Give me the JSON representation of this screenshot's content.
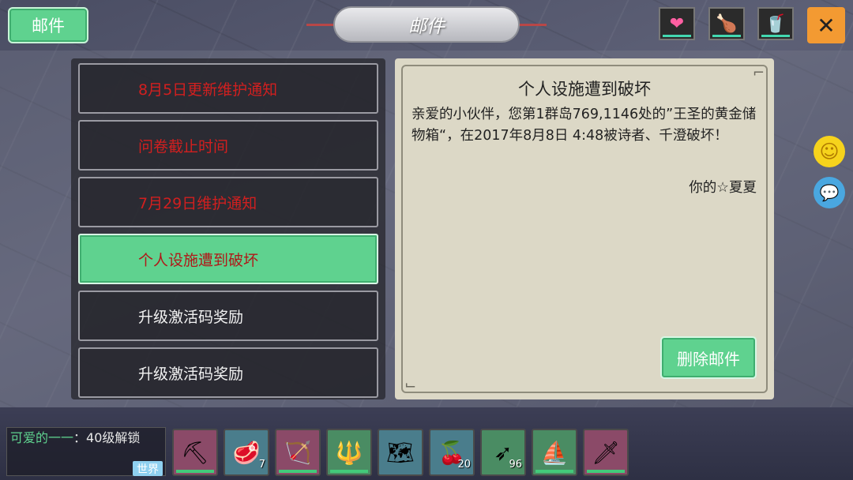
{
  "header": {
    "mail_button_label": "邮件",
    "title": "邮件",
    "status_icons": [
      {
        "name": "heart-icon",
        "glyph": "❤",
        "color": "#ff5fa2"
      },
      {
        "name": "drumstick-icon",
        "glyph": "🍗",
        "color": "#e7c36a"
      },
      {
        "name": "cup-icon",
        "glyph": "🥤",
        "color": "#43d8b0"
      }
    ],
    "close_glyph": "✕"
  },
  "mail_list": [
    {
      "title": "8月5日更新维护通知",
      "state": "unread"
    },
    {
      "title": "问卷截止时间",
      "state": "unread"
    },
    {
      "title": "7月29日维护通知",
      "state": "unread"
    },
    {
      "title": "个人设施遭到破坏",
      "state": "selected"
    },
    {
      "title": "升级激活码奖励",
      "state": "read"
    },
    {
      "title": "升级激活码奖励",
      "state": "read"
    }
  ],
  "detail": {
    "title": "个人设施遭到破坏",
    "body": "亲爱的小伙伴，您第1群岛769,1146处的”王圣的黄金储物箱“，在2017年8月8日 4:48被诗者、千澄破坏！",
    "signature": "你的☆夏夏",
    "delete_label": "删除邮件"
  },
  "side_icons": [
    {
      "name": "smiley-icon",
      "glyph": "☺",
      "color": "#f6d31c"
    },
    {
      "name": "chat-bubble-icon",
      "glyph": "💬",
      "color": "#4aa7e0"
    }
  ],
  "chat": {
    "name": "可爱的一一",
    "message": "：40级解锁",
    "channel": "世界"
  },
  "hotbar": [
    {
      "name": "pickaxe-icon",
      "glyph": "⛏",
      "count": "",
      "bg": "#8b4a68"
    },
    {
      "name": "steak-icon",
      "glyph": "🥩",
      "count": "7",
      "bg": "#4a7d8c"
    },
    {
      "name": "bow-icon",
      "glyph": "🏹",
      "count": "",
      "bg": "#8b4a68"
    },
    {
      "name": "spear-icon",
      "glyph": "🔱",
      "count": "",
      "bg": "#4a8c63"
    },
    {
      "name": "map-icon",
      "glyph": "🗺",
      "count": "",
      "bg": "#4a7d8c"
    },
    {
      "name": "berries-icon",
      "glyph": "🍒",
      "count": "20",
      "bg": "#4a7d8c"
    },
    {
      "name": "arrow-icon",
      "glyph": "➶",
      "count": "96",
      "bg": "#4a8c63"
    },
    {
      "name": "boat-icon",
      "glyph": "⛵",
      "count": "",
      "bg": "#4a8c63"
    },
    {
      "name": "crystal-sword-icon",
      "glyph": "🗡",
      "count": "",
      "bg": "#8b4a68"
    }
  ]
}
